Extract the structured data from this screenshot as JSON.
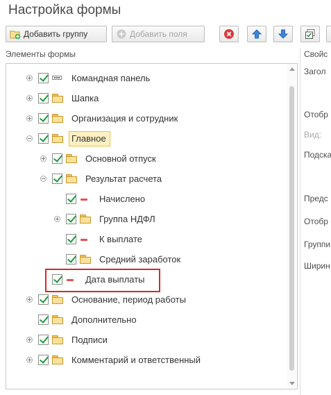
{
  "window": {
    "title": "Настройка формы"
  },
  "toolbar": {
    "add_group_label": "Добавить группу",
    "add_fields_label": "Добавить поля",
    "delete_icon": "delete-icon",
    "move_up_icon": "arrow-up-icon",
    "move_down_icon": "arrow-down-icon",
    "checklist_icon": "check-list-icon"
  },
  "tree": {
    "header": "Элементы формы",
    "items": [
      {
        "label": "Командная панель",
        "icon": "command-panel-icon",
        "checked": true,
        "expander": "plus"
      },
      {
        "label": "Шапка",
        "icon": "folder-icon",
        "checked": true,
        "expander": "plus"
      },
      {
        "label": "Организация и сотрудник",
        "icon": "folder-icon",
        "checked": true,
        "expander": "plus"
      },
      {
        "label": "Главное",
        "icon": "folder-icon",
        "checked": true,
        "expander": "minus",
        "selected": true
      },
      {
        "label": "Основной отпуск",
        "icon": "folder-icon",
        "checked": true,
        "expander": "plus"
      },
      {
        "label": "Результат расчета",
        "icon": "folder-icon",
        "checked": true,
        "expander": "minus"
      },
      {
        "label": "Начислено",
        "icon": "field-icon",
        "checked": true,
        "expander": "none"
      },
      {
        "label": "Группа НДФЛ",
        "icon": "folder-icon",
        "checked": true,
        "expander": "plus"
      },
      {
        "label": "К выплате",
        "icon": "field-icon",
        "checked": true,
        "expander": "none"
      },
      {
        "label": "Средний заработок",
        "icon": "folder-icon",
        "checked": true,
        "expander": "none"
      },
      {
        "label": "Дата выплаты",
        "icon": "field-icon",
        "checked": true,
        "expander": "none",
        "highlighted": true
      },
      {
        "label": "Основание, период работы",
        "icon": "folder-icon",
        "checked": true,
        "expander": "plus"
      },
      {
        "label": "Дополнительно",
        "icon": "folder-icon",
        "checked": true,
        "expander": "none"
      },
      {
        "label": "Подписи",
        "icon": "folder-icon",
        "checked": true,
        "expander": "plus"
      },
      {
        "label": "Комментарий и ответственный",
        "icon": "folder-icon",
        "checked": true,
        "expander": "plus"
      }
    ]
  },
  "properties": {
    "header": "Свойс",
    "labels": [
      "Загол",
      "Отобр",
      "Вид:",
      "Подска",
      "Предс",
      "Отобр",
      "Группи",
      "Ширин"
    ]
  },
  "colors": {
    "check": "#1f9b3e",
    "highlight_border": "#d22a2a",
    "selection": "#fdf0c2",
    "folder": "#fbe19a"
  }
}
